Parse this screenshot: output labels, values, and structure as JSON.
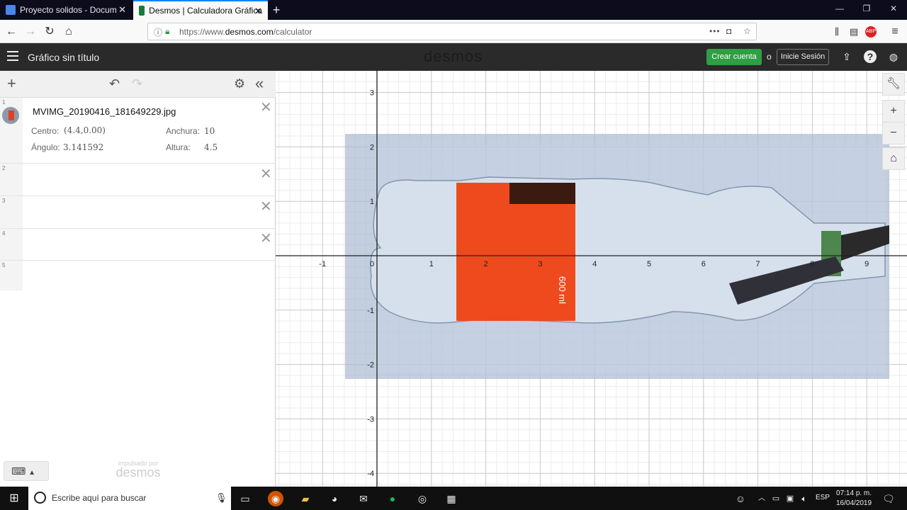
{
  "browser": {
    "tabs": [
      {
        "title": "Proyecto solidos - Documento",
        "active": false
      },
      {
        "title": "Desmos | Calculadora Gráfica",
        "active": true
      }
    ],
    "url_prefix": "https://www.",
    "url_host": "desmos.com",
    "url_path": "/calculator"
  },
  "header": {
    "title": "Gráfico sin título",
    "logo": "desmos",
    "create_account": "Crear cuenta",
    "or": "o",
    "login": "Inicie Sesión"
  },
  "expressions": [
    {
      "num": "1",
      "image_name": "MVIMG_20190416_181649229.jpg",
      "centro_label": "Centro:",
      "centro_value": "(4.4,0.00)",
      "anchura_label": "Anchura:",
      "anchura_value": "10",
      "angulo_label": "Ángulo:",
      "angulo_value": "3.141592",
      "altura_label": "Altura:",
      "altura_value": "4.5"
    },
    {
      "num": "2"
    },
    {
      "num": "3"
    },
    {
      "num": "4"
    },
    {
      "num": "5"
    }
  ],
  "powered_by": {
    "small": "impulsado por",
    "brand": "desmos"
  },
  "graph": {
    "x_ticks": [
      "-1",
      "0",
      "1",
      "2",
      "3",
      "4",
      "5",
      "6",
      "7",
      "8",
      "9"
    ],
    "y_ticks": [
      "3",
      "2",
      "1",
      "-1",
      "-2",
      "-3",
      "-4"
    ],
    "bottle_label": "600 ml"
  },
  "taskbar": {
    "search_placeholder": "Escribe aquí para buscar",
    "lang": "ESP",
    "time": "07:14 p. m.",
    "date": "16/04/2019"
  }
}
